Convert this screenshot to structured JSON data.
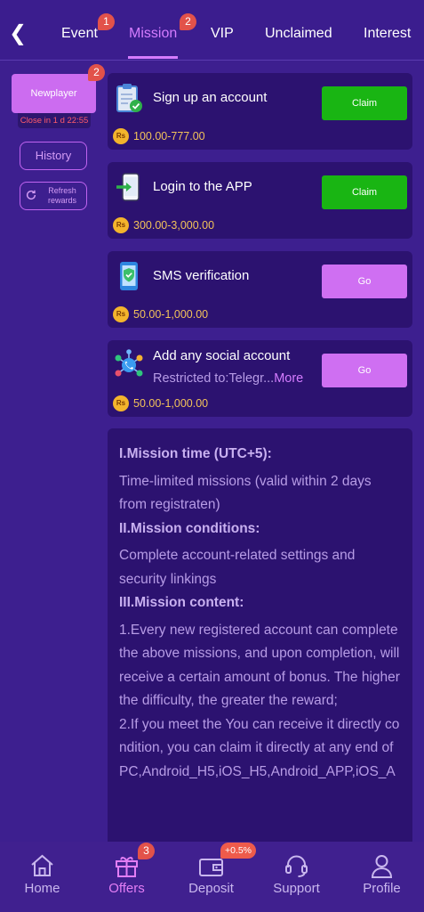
{
  "header": {
    "tabs": [
      {
        "label": "Event",
        "badge": "1"
      },
      {
        "label": "Mission",
        "badge": "2",
        "active": true
      },
      {
        "label": "VIP"
      },
      {
        "label": "Unclaimed"
      },
      {
        "label": "Interest"
      }
    ]
  },
  "sidebar": {
    "newplayer": {
      "label": "Newplayer",
      "badge": "2",
      "timer": "Close in 1 d 22:55"
    },
    "history_label": "History",
    "refresh_label": "Refresh rewards"
  },
  "missions": [
    {
      "title": "Sign up an account",
      "reward": "100.00-777.00",
      "button": "Claim",
      "button_kind": "claim",
      "icon": "clipboard-check-icon"
    },
    {
      "title": "Login to the APP",
      "reward": "300.00-3,000.00",
      "button": "Claim",
      "button_kind": "claim",
      "icon": "phone-login-icon"
    },
    {
      "title": "SMS verification",
      "reward": "50.00-1,000.00",
      "button": "Go",
      "button_kind": "go",
      "icon": "shield-phone-icon"
    },
    {
      "title": "Add any social account",
      "subtitle": "Restricted to:Telegr...",
      "more": "More",
      "reward": "50.00-1,000.00",
      "button": "Go",
      "button_kind": "go",
      "icon": "social-network-icon"
    }
  ],
  "currency_symbol": "Rs",
  "rules": {
    "h1": "I.Mission time (UTC+5):",
    "p1": "Time-limited missions (valid within 2 days from registraten)",
    "h2": "II.Mission conditions:",
    "p2": "Complete account-related settings and security linkings",
    "h3": "III.Mission content:",
    "p3": "1.Every new registered account can complete the above missions, and upon completion, will receive a certain amount of bonus. The higher the difficulty, the greater the reward;",
    "p4": "2.If you meet the You can receive it directly condition, you can claim it directly at any end of PC,Android_H5,iOS_H5,Android_APP,iOS_A"
  },
  "bottom_nav": [
    {
      "label": "Home",
      "icon": "home-icon"
    },
    {
      "label": "Offers",
      "icon": "gift-icon",
      "badge": "3",
      "active": true
    },
    {
      "label": "Deposit",
      "icon": "wallet-icon",
      "badge": "+0.5%"
    },
    {
      "label": "Support",
      "icon": "headset-icon"
    },
    {
      "label": "Profile",
      "icon": "profile-icon"
    }
  ],
  "colors": {
    "background": "#3d1f8f",
    "card": "#2c1270",
    "accent": "#d57cff",
    "claim_green": "#19b513",
    "go_purple": "#cf6ff2",
    "reward_gold": "#f2c25a",
    "badge_red": "#e2524a"
  }
}
